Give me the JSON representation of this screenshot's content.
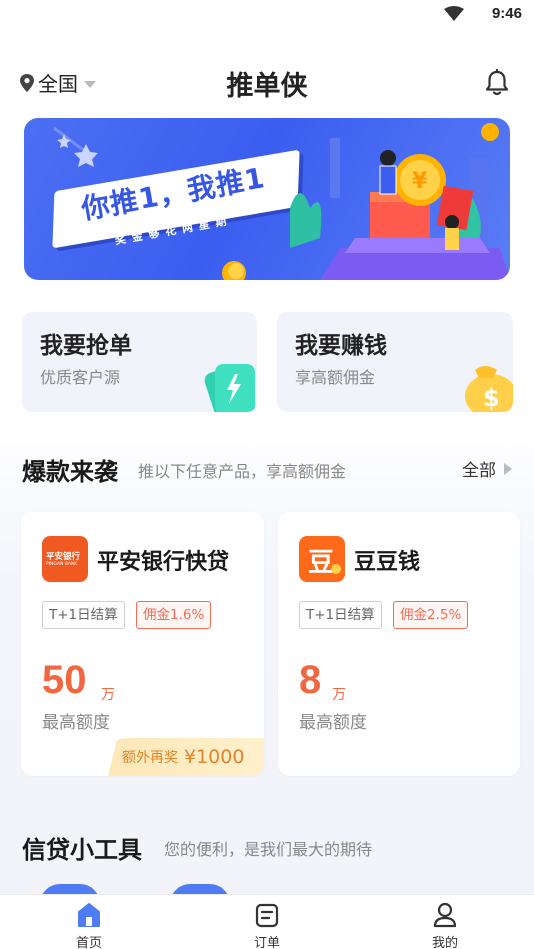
{
  "status_bar": {
    "time": "9:46"
  },
  "header": {
    "location": "全国",
    "title": "推单侠"
  },
  "banner": {
    "slogan": "你推1，我推1",
    "sub": "奖金够花两星期"
  },
  "quick_cards": [
    {
      "title": "我要抢单",
      "subtitle": "优质客户源"
    },
    {
      "title": "我要赚钱",
      "subtitle": "享高额佣金"
    }
  ],
  "hot_section": {
    "title": "爆款来袭",
    "desc": "推以下任意产品，享高额佣金",
    "more": "全部"
  },
  "products": [
    {
      "name": "平安银行快贷",
      "logo_text": "平安银行",
      "logo_sub": "PINGAN BANK",
      "tag_settle": "T+1日结算",
      "tag_commission": "佣金1.6%",
      "amount": "50",
      "unit": "万",
      "amount_label": "最高额度",
      "bonus_label": "额外再奖",
      "bonus_value": "¥1000"
    },
    {
      "name": "豆豆钱",
      "logo_text": "豆",
      "tag_settle": "T+1日结算",
      "tag_commission": "佣金2.5%",
      "amount": "8",
      "unit": "万",
      "amount_label": "最高额度"
    }
  ],
  "tools_section": {
    "title": "信贷小工具",
    "desc": "您的便利，是我们最大的期待"
  },
  "nav": [
    {
      "label": "首页",
      "icon": "home-icon",
      "active": true
    },
    {
      "label": "订单",
      "icon": "order-icon",
      "active": false
    },
    {
      "label": "我的",
      "icon": "profile-icon",
      "active": false
    }
  ],
  "colors": {
    "primary": "#4f7cf5",
    "accent": "#f2673f",
    "commission": "#f06d5a",
    "bonus": "#e2852a"
  }
}
